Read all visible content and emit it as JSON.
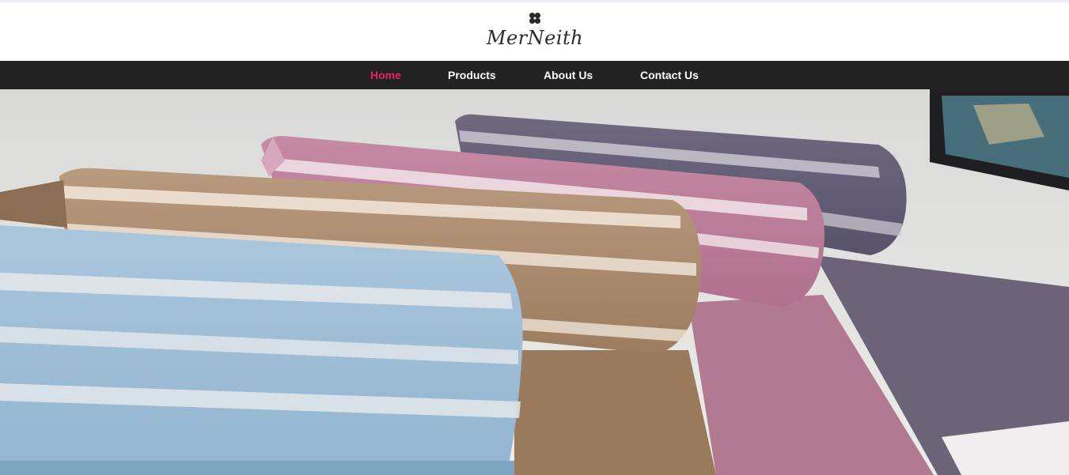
{
  "brand": {
    "name": "MerNeith",
    "logo_icon": "four-petal-flower-icon"
  },
  "nav": {
    "items": [
      {
        "label": "Home",
        "active": true
      },
      {
        "label": "Products",
        "active": false
      },
      {
        "label": "About Us",
        "active": false
      },
      {
        "label": "Contact Us",
        "active": false
      }
    ],
    "active_color": "#e8245f",
    "bar_color": "#222222"
  },
  "hero": {
    "subject": "rolled striped scarves"
  }
}
